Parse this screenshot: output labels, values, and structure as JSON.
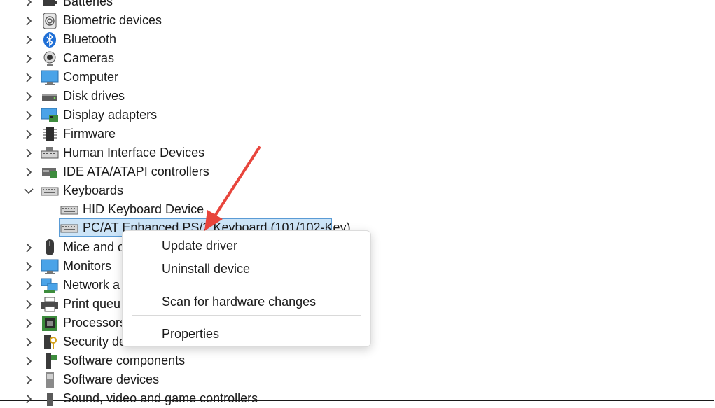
{
  "tree": {
    "items": [
      {
        "label": "Batteries",
        "state": "collapsed",
        "icon": "battery-icon"
      },
      {
        "label": "Biometric devices",
        "state": "collapsed",
        "icon": "fingerprint-icon"
      },
      {
        "label": "Bluetooth",
        "state": "collapsed",
        "icon": "bluetooth-icon"
      },
      {
        "label": "Cameras",
        "state": "collapsed",
        "icon": "camera-icon"
      },
      {
        "label": "Computer",
        "state": "collapsed",
        "icon": "monitor-icon"
      },
      {
        "label": "Disk drives",
        "state": "collapsed",
        "icon": "disk-drive-icon"
      },
      {
        "label": "Display adapters",
        "state": "collapsed",
        "icon": "display-adapter-icon"
      },
      {
        "label": "Firmware",
        "state": "collapsed",
        "icon": "chip-icon"
      },
      {
        "label": "Human Interface Devices",
        "state": "collapsed",
        "icon": "hid-icon"
      },
      {
        "label": "IDE ATA/ATAPI controllers",
        "state": "collapsed",
        "icon": "ide-controller-icon"
      },
      {
        "label": "Keyboards",
        "state": "expanded",
        "icon": "keyboard-icon"
      },
      {
        "label": "HID Keyboard Device",
        "state": "child",
        "icon": "keyboard-icon"
      },
      {
        "label": "PC/AT Enhanced PS/2 Keyboard (101/102-Key)",
        "state": "child-selected",
        "icon": "keyboard-icon"
      },
      {
        "label": "Mice and o",
        "state": "collapsed",
        "icon": "mouse-icon"
      },
      {
        "label": "Monitors",
        "state": "collapsed",
        "icon": "monitor-icon"
      },
      {
        "label": "Network a",
        "state": "collapsed",
        "icon": "network-icon"
      },
      {
        "label": "Print queu",
        "state": "collapsed",
        "icon": "printer-icon"
      },
      {
        "label": "Processors",
        "state": "collapsed",
        "icon": "processor-icon"
      },
      {
        "label": "Security de",
        "state": "collapsed",
        "icon": "security-icon"
      },
      {
        "label": "Software components",
        "state": "collapsed",
        "icon": "software-component-icon"
      },
      {
        "label": "Software devices",
        "state": "collapsed",
        "icon": "software-device-icon"
      },
      {
        "label": "Sound, video and game controllers",
        "state": "collapsed",
        "icon": "speaker-icon"
      }
    ]
  },
  "context_menu": {
    "items": [
      {
        "label": "Update driver"
      },
      {
        "label": "Uninstall device"
      },
      {
        "label": "Scan for hardware changes"
      },
      {
        "label": "Properties"
      }
    ]
  },
  "colors": {
    "selection_bg": "#cce4f7",
    "selection_border": "#5a9bd5",
    "annotation_arrow": "#e8453c"
  }
}
